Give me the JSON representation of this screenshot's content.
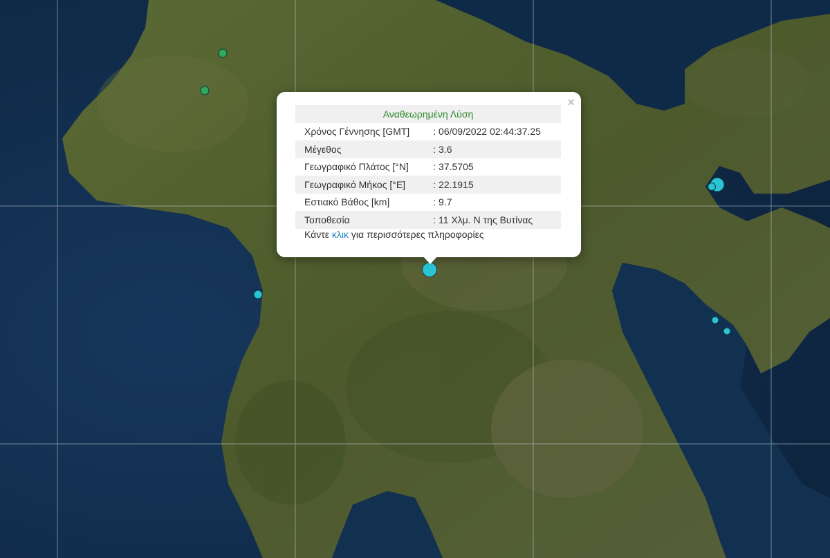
{
  "popup": {
    "title": "Αναθεωρημένη Λύση",
    "close_symbol": "×",
    "rows": [
      {
        "label": "Χρόνος Γέννησης [GMT]",
        "value": ": 06/09/2022 02:44:37.25"
      },
      {
        "label": "Μέγεθος",
        "value": ": 3.6"
      },
      {
        "label": "Γεωγραφικό Πλάτος [°N]",
        "value": ": 37.5705"
      },
      {
        "label": "Γεωγραφικό Μήκος [°E]",
        "value": ": 22.1915"
      },
      {
        "label": "Εστιακό Βάθος [km]",
        "value": ": 9.7"
      },
      {
        "label": "Τοποθεσία",
        "value": ": 11 Χλμ. Ν της Βυτίνας"
      }
    ],
    "more_prefix": "Κάντε ",
    "more_link": "κλικ",
    "more_suffix": " για περισσότερες πληροφορίες"
  },
  "colors": {
    "sea": "#12304f",
    "land": "#4a5a2e",
    "marker_green": "#2fa85a",
    "marker_cyan": "#2bc4d6",
    "popup_title": "#2d8a2d",
    "link": "#1a7fc1"
  }
}
